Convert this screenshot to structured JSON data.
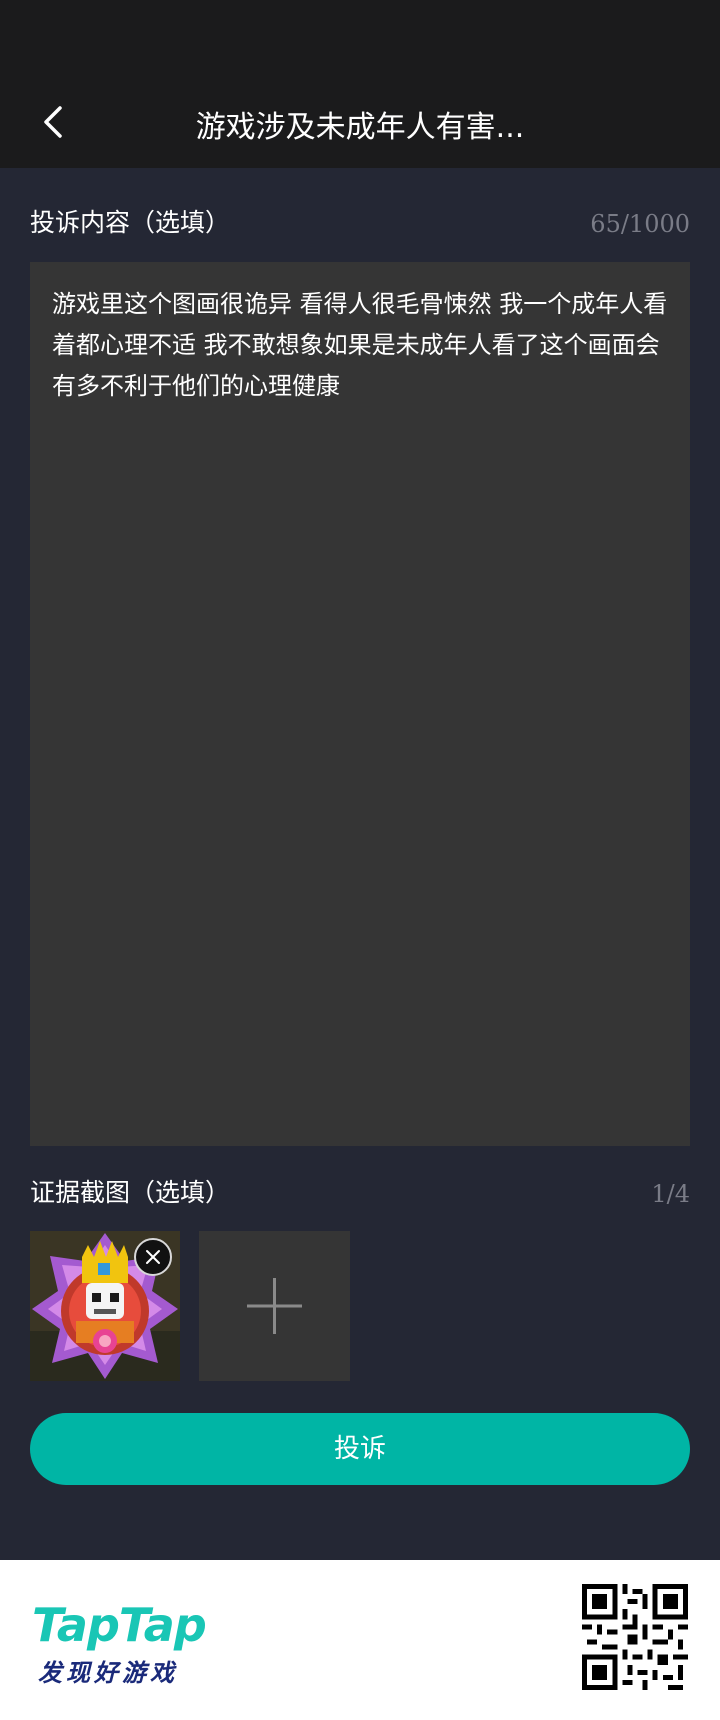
{
  "header": {
    "back_icon": "chevron-left-icon",
    "title": "游戏涉及未成年人有害..."
  },
  "complaint": {
    "label": "投诉内容（选填）",
    "counter": "65/1000",
    "text": "游戏里这个图画很诡异 看得人很毛骨悚然 我一个成年人看着都心理不适 我不敢想象如果是未成年人看了这个画面会有多不利于他们的心理健康"
  },
  "evidence": {
    "label": "证据截图（选填）",
    "counter": "1/4",
    "remove_icon": "close-icon",
    "add_icon": "plus-icon"
  },
  "submit": {
    "label": "投诉"
  },
  "footer": {
    "brand": "TapTap",
    "slogan": "发现好游戏",
    "qr_icon": "qr-code-icon"
  },
  "colors": {
    "accent": "#00b5a5",
    "background": "#242734",
    "header": "#1b1b1c",
    "input": "#353535"
  }
}
